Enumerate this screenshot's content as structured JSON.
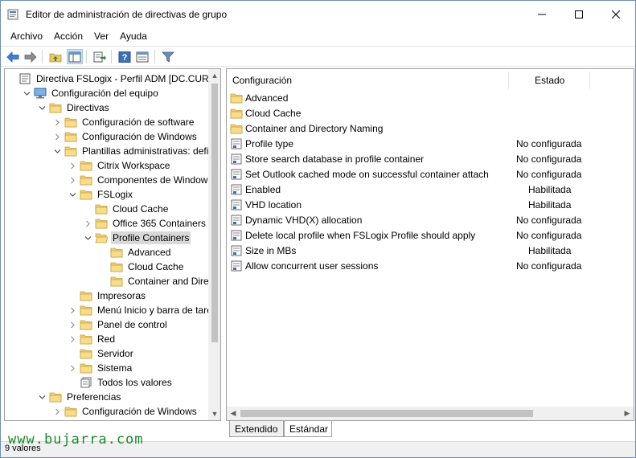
{
  "window": {
    "title": "Editor de administración de directivas de grupo"
  },
  "menu": [
    "Archivo",
    "Acción",
    "Ver",
    "Ayuda"
  ],
  "tree": [
    {
      "label": "Directiva FSLogix - Perfil ADM [DC.CURSO.L",
      "level": 0,
      "arrow": "",
      "icon": "policy-icon"
    },
    {
      "label": "Configuración del equipo",
      "level": 1,
      "arrow": "down",
      "icon": "computer-icon"
    },
    {
      "label": "Directivas",
      "level": 2,
      "arrow": "down",
      "icon": "folder-icon"
    },
    {
      "label": "Configuración de software",
      "level": 3,
      "arrow": "right",
      "icon": "folder-icon"
    },
    {
      "label": "Configuración de Windows",
      "level": 3,
      "arrow": "right",
      "icon": "folder-icon"
    },
    {
      "label": "Plantillas administrativas: definic",
      "level": 3,
      "arrow": "down",
      "icon": "folder-icon"
    },
    {
      "label": "Citrix Workspace",
      "level": 4,
      "arrow": "right",
      "icon": "folder-icon"
    },
    {
      "label": "Componentes de Windows",
      "level": 4,
      "arrow": "right",
      "icon": "folder-icon"
    },
    {
      "label": "FSLogix",
      "level": 4,
      "arrow": "down",
      "icon": "folder-icon"
    },
    {
      "label": "Cloud Cache",
      "level": 5,
      "arrow": "",
      "icon": "folder-icon"
    },
    {
      "label": "Office 365 Containers",
      "level": 5,
      "arrow": "right",
      "icon": "folder-icon"
    },
    {
      "label": "Profile Containers",
      "level": 5,
      "arrow": "down",
      "icon": "folder-open-icon",
      "selected": true
    },
    {
      "label": "Advanced",
      "level": 6,
      "arrow": "",
      "icon": "folder-icon"
    },
    {
      "label": "Cloud Cache",
      "level": 6,
      "arrow": "",
      "icon": "folder-icon"
    },
    {
      "label": "Container and Directo",
      "level": 6,
      "arrow": "",
      "icon": "folder-icon"
    },
    {
      "label": "Impresoras",
      "level": 4,
      "arrow": "",
      "icon": "folder-icon"
    },
    {
      "label": "Menú Inicio y barra de tareas",
      "level": 4,
      "arrow": "right",
      "icon": "folder-icon"
    },
    {
      "label": "Panel de control",
      "level": 4,
      "arrow": "right",
      "icon": "folder-icon"
    },
    {
      "label": "Red",
      "level": 4,
      "arrow": "right",
      "icon": "folder-icon"
    },
    {
      "label": "Servidor",
      "level": 4,
      "arrow": "",
      "icon": "folder-icon"
    },
    {
      "label": "Sistema",
      "level": 4,
      "arrow": "right",
      "icon": "folder-icon"
    },
    {
      "label": "Todos los valores",
      "level": 4,
      "arrow": "",
      "icon": "all-settings-icon"
    },
    {
      "label": "Preferencias",
      "level": 2,
      "arrow": "down",
      "icon": "folder-icon"
    },
    {
      "label": "Configuración de Windows",
      "level": 3,
      "arrow": "right",
      "icon": "folder-icon"
    }
  ],
  "list": {
    "columns": {
      "setting": "Configuración",
      "state": "Estado"
    },
    "rows": [
      {
        "name": "Advanced",
        "state": "",
        "icon": "folder-icon"
      },
      {
        "name": "Cloud Cache",
        "state": "",
        "icon": "folder-icon"
      },
      {
        "name": "Container and Directory Naming",
        "state": "",
        "icon": "folder-icon"
      },
      {
        "name": "Profile type",
        "state": "No configurada",
        "icon": "setting-icon"
      },
      {
        "name": "Store search database in profile container",
        "state": "No configurada",
        "icon": "setting-icon"
      },
      {
        "name": "Set Outlook cached mode on successful container attach",
        "state": "No configurada",
        "icon": "setting-icon"
      },
      {
        "name": "Enabled",
        "state": "Habilitada",
        "icon": "setting-icon"
      },
      {
        "name": "VHD location",
        "state": "Habilitada",
        "icon": "setting-icon"
      },
      {
        "name": "Dynamic VHD(X) allocation",
        "state": "No configurada",
        "icon": "setting-icon"
      },
      {
        "name": "Delete local profile when FSLogix Profile should apply",
        "state": "No configurada",
        "icon": "setting-icon"
      },
      {
        "name": "Size in MBs",
        "state": "Habilitada",
        "icon": "setting-icon"
      },
      {
        "name": "Allow concurrent user sessions",
        "state": "No configurada",
        "icon": "setting-icon"
      }
    ]
  },
  "tabs": {
    "extended": "Extendido",
    "standard": "Estándar",
    "active": "standard"
  },
  "status": {
    "text": "9 valores"
  },
  "watermark": "www.bujarra.com"
}
